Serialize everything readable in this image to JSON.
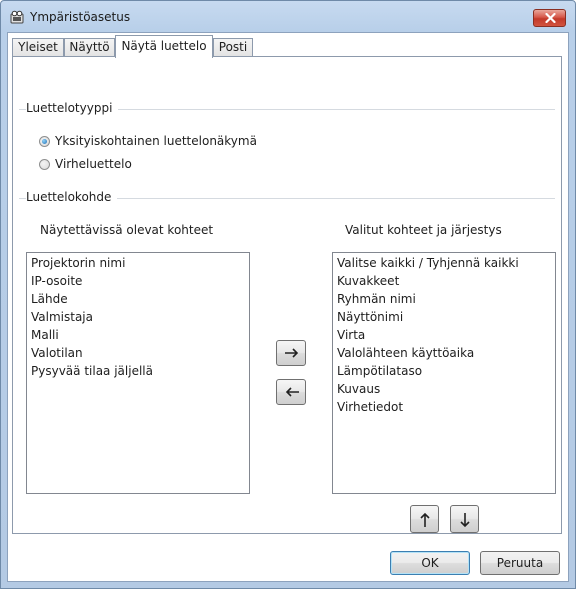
{
  "window": {
    "title": "Ympäristöasetus",
    "app_icon": "settings-app-icon",
    "close_icon": "close-icon"
  },
  "tabs": [
    {
      "label": "Yleiset",
      "active": false
    },
    {
      "label": "Näyttö",
      "active": false
    },
    {
      "label": "Näytä luettelo",
      "active": true
    },
    {
      "label": "Posti",
      "active": false
    }
  ],
  "list_type": {
    "heading": "Luettelotyyppi",
    "options": [
      {
        "label": "Yksityiskohtainen luettelonäkymä",
        "selected": true
      },
      {
        "label": "Virheluettelo",
        "selected": false
      }
    ]
  },
  "list_items": {
    "heading": "Luettelokohde",
    "available": {
      "caption": "Näytettävissä olevat kohteet",
      "items": [
        "Projektorin nimi",
        "IP-osoite",
        "Lähde",
        "Valmistaja",
        "Malli",
        "Valotilan",
        "Pysyvää tilaa jäljellä"
      ]
    },
    "selected": {
      "caption": "Valitut kohteet ja järjestys",
      "items": [
        "Valitse kaikki / Tyhjennä kaikki",
        "Kuvakkeet",
        "Ryhmän nimi",
        "Näyttönimi",
        "Virta",
        "Valolähteen käyttöaika",
        "Lämpötilataso",
        "Kuvaus",
        "Virhetiedot"
      ]
    },
    "add_icon": "arrow-right-icon",
    "remove_icon": "arrow-left-icon",
    "move_up_icon": "arrow-up-icon",
    "move_down_icon": "arrow-down-icon"
  },
  "buttons": {
    "ok": "OK",
    "cancel": "Peruuta"
  },
  "colors": {
    "window_frame": "#b8cfe9",
    "close_button": "#c9473a",
    "radio_selected": "#1f6fb5"
  }
}
